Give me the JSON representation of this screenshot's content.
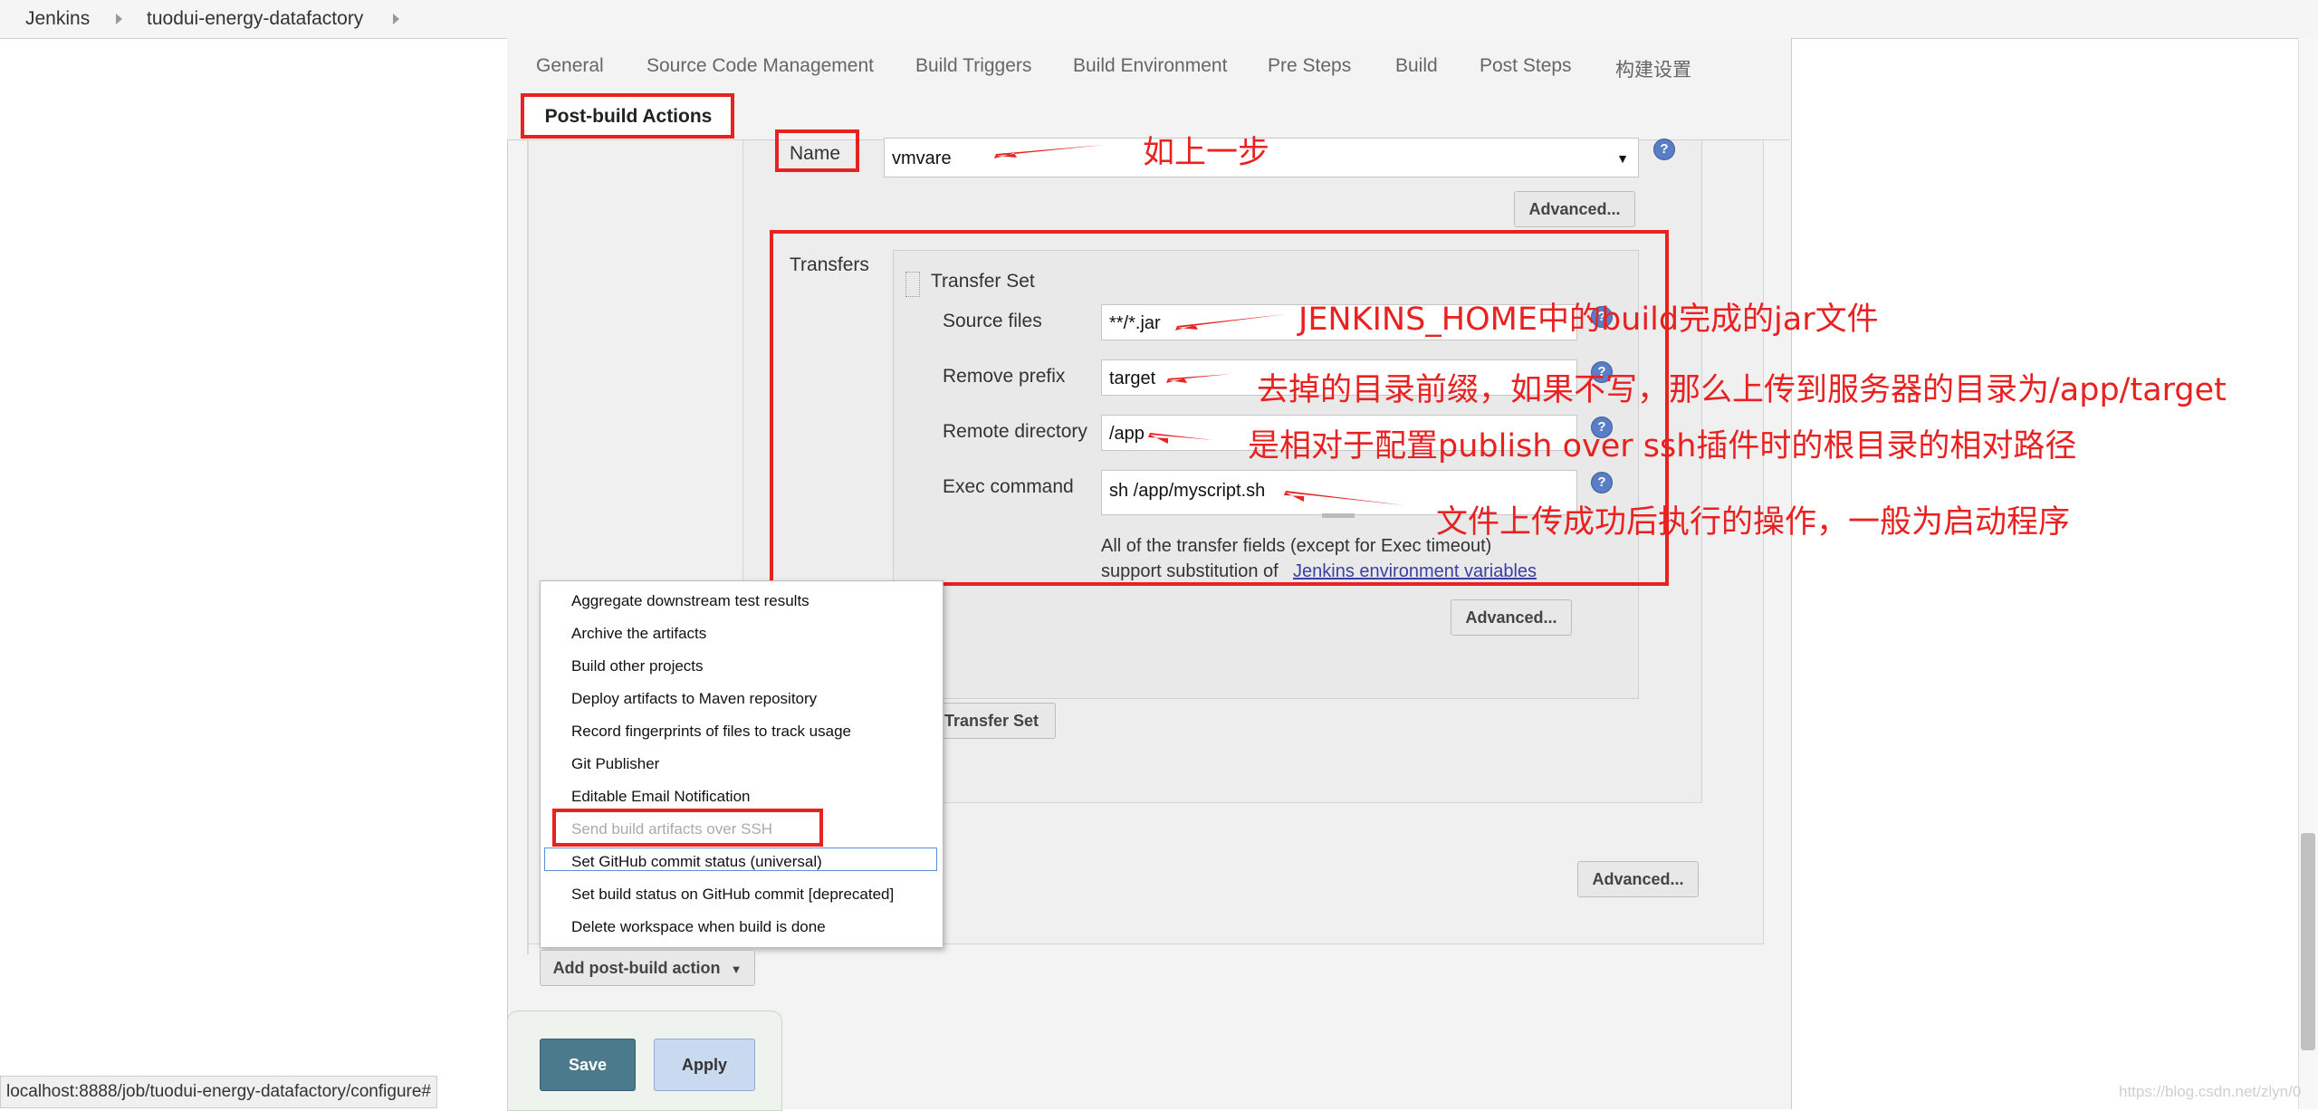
{
  "breadcrumb": {
    "root": "Jenkins",
    "job": "tuodui-energy-datafactory"
  },
  "tabs": [
    "General",
    "Source Code Management",
    "Build Triggers",
    "Build Environment",
    "Pre Steps",
    "Build",
    "Post Steps",
    "构建设置"
  ],
  "active_tab": "Post-build Actions",
  "name_field": {
    "label": "Name",
    "value": "vmvare"
  },
  "advanced_label": "Advanced...",
  "transfers_label": "Transfers",
  "transfer_set_title": "Transfer Set",
  "fields": {
    "source_files": {
      "label": "Source files",
      "value": "**/*.jar"
    },
    "remove_prefix": {
      "label": "Remove prefix",
      "value": "target"
    },
    "remote_directory": {
      "label": "Remote directory",
      "value": "/app"
    },
    "exec_command": {
      "label": "Exec command",
      "value": "sh /app/myscript.sh"
    }
  },
  "transfer_note_line1": "All of the transfer fields (except for Exec timeout)",
  "transfer_note_line2": "support substitution of",
  "transfer_note_link": "Jenkins environment variables",
  "add_transfer_set_label": "Transfer Set",
  "menu_items": [
    "Aggregate downstream test results",
    "Archive the artifacts",
    "Build other projects",
    "Deploy artifacts to Maven repository",
    "Record fingerprints of files to track usage",
    "Git Publisher",
    "Editable Email Notification",
    "Send build artifacts over SSH",
    "Set GitHub commit status (universal)",
    "Set build status on GitHub commit [deprecated]",
    "Delete workspace when build is done"
  ],
  "add_post_build_label": "Add post-build action",
  "save_label": "Save",
  "apply_label": "Apply",
  "status_url": "localhost:8888/job/tuodui-energy-datafactory/configure#",
  "watermark": "https://blog.csdn.net/zlyn/0",
  "annotations": {
    "name": "如上一步",
    "source": "JENKINS_HOME中的build完成的jar文件",
    "prefix": "去掉的目录前缀，如果不写，那么上传到服务器的目录为/app/target",
    "remote": "是相对于配置publish over ssh插件时的根目录的相对路径",
    "exec": "文件上传成功后执行的操作，一般为启动程序"
  },
  "colors": {
    "annotation_red": "#e82121",
    "save_button": "#4a7a8c",
    "apply_button": "#c9daf0"
  }
}
